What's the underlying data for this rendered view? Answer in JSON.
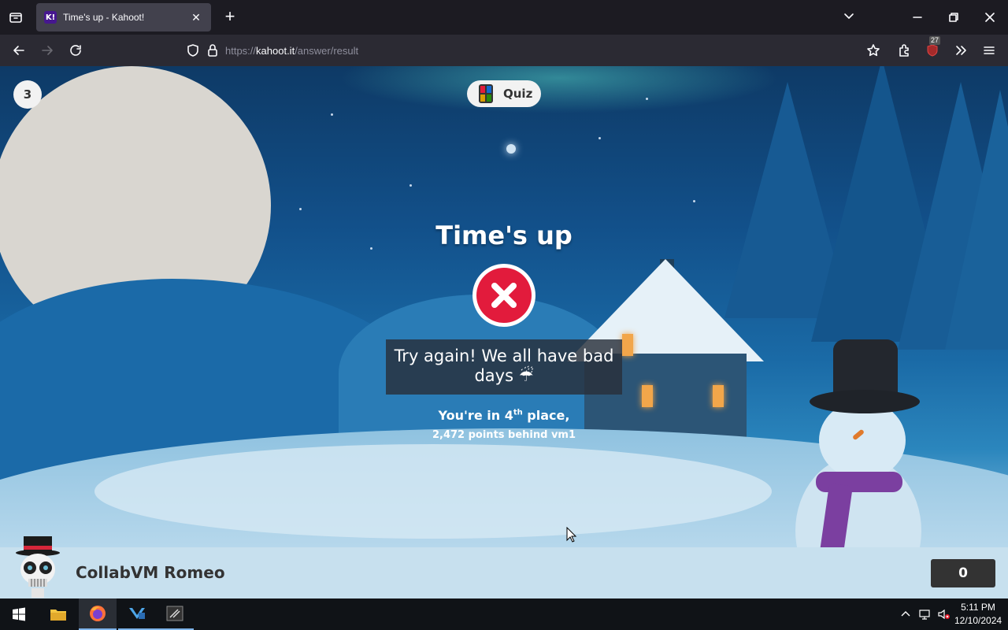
{
  "browser": {
    "tab": {
      "title": "Time's up - Kahoot!",
      "favicon_text": "K!"
    },
    "url": {
      "protocol": "https://",
      "domain": "kahoot.it",
      "path": "/answer/result"
    },
    "extension_badge": "27"
  },
  "game": {
    "question_number": "3",
    "quiz_label": "Quiz",
    "title": "Time's up",
    "message": "Try again! We all have bad days ☔",
    "place_prefix": "You're in 4",
    "place_suffix_sup": "th",
    "place_rest": " place,",
    "points_behind": "2,472 points behind vm1"
  },
  "player": {
    "name": "CollabVM Romeo",
    "score": "0"
  },
  "taskbar": {
    "time": "5:11 PM",
    "date": "12/10/2024"
  },
  "colors": {
    "wrong_red": "#e21b3c",
    "kahoot_purple": "#46178f",
    "footer_bg": "#c7e0ee"
  }
}
